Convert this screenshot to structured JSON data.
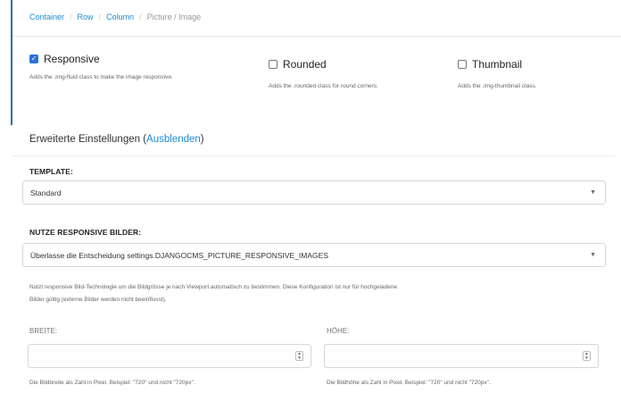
{
  "breadcrumb": {
    "items": [
      "Container",
      "Row",
      "Column"
    ],
    "current": "Picture / Image"
  },
  "options": {
    "responsive": {
      "label": "Responsive",
      "checked": true,
      "help": "Adds the .img-fluid class to make the image responsive."
    },
    "rounded": {
      "label": "Rounded",
      "checked": false,
      "help": "Adds the .rounded class for round corners."
    },
    "thumbnail": {
      "label": "Thumbnail",
      "checked": false,
      "help": "Adds the .img-thumbnail class."
    }
  },
  "advanced": {
    "label": "Erweiterte Einstellungen (",
    "toggle": "Ausblenden",
    "close": ")"
  },
  "template": {
    "label": "TEMPLATE:",
    "value": "Standard"
  },
  "responsive_images": {
    "label": "NUTZE RESPONSIVE BILDER:",
    "value": "Überlasse die Entscheidung settings.DJANGOCMS_PICTURE_RESPONSIVE_IMAGES",
    "help_line1": "Nutzt responsive Bild-Technologie um die Bildgrösse je nach Viewport automatisch zu bestimmen. Diese Konfiguration ist nur für hochgeladene",
    "help_line2": "Bilder gültig (externe Bilder werden nicht beeinflusst)."
  },
  "width": {
    "label": "BREITE:",
    "value": "",
    "help": "Die Bildbreite als Zahl in Pixel. Beispiel: \"720\" und nicht \"720px\"."
  },
  "height": {
    "label": "HÖHE:",
    "value": "",
    "help": "Die Bildhöhe als Zahl in Pixel. Beispiel: \"720\" und nicht \"720px\"."
  },
  "colors": {
    "accent": "#1a8bd6",
    "checkbox_checked": "#2a72d6"
  },
  "icons": {
    "select_caret": "chevron-down-icon",
    "spinner": "number-spinner-icon"
  }
}
